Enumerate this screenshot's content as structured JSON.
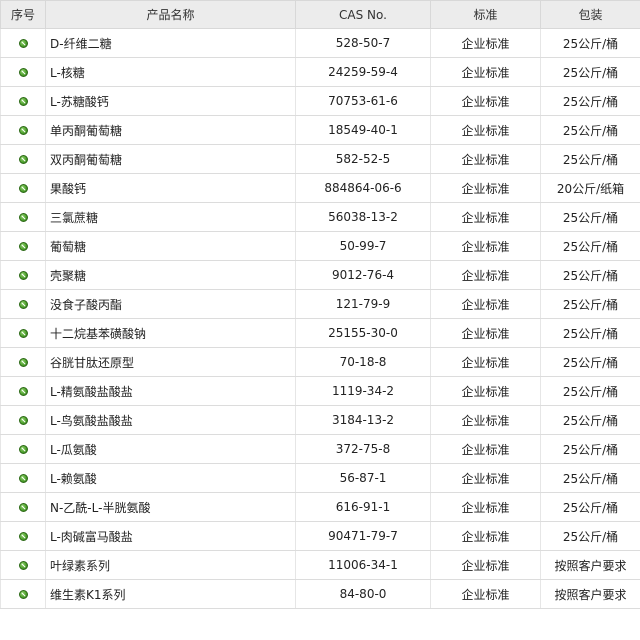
{
  "table": {
    "headers": [
      "序号",
      "产品名称",
      "CAS No.",
      "标准",
      "包装"
    ],
    "rows": [
      {
        "name": "D-纤维二糖",
        "cas": "528-50-7",
        "standard": "企业标准",
        "packaging": "25公斤/桶"
      },
      {
        "name": "L-核糖",
        "cas": "24259-59-4",
        "standard": "企业标准",
        "packaging": "25公斤/桶"
      },
      {
        "name": "L-苏糖酸钙",
        "cas": "70753-61-6",
        "standard": "企业标准",
        "packaging": "25公斤/桶"
      },
      {
        "name": "单丙酮葡萄糖",
        "cas": "18549-40-1",
        "standard": "企业标准",
        "packaging": "25公斤/桶"
      },
      {
        "name": "双丙酮葡萄糖",
        "cas": "582-52-5",
        "standard": "企业标准",
        "packaging": "25公斤/桶"
      },
      {
        "name": "果酸钙",
        "cas": "884864-06-6",
        "standard": "企业标准",
        "packaging": "20公斤/纸箱"
      },
      {
        "name": "三氯蔗糖",
        "cas": "56038-13-2",
        "standard": "企业标准",
        "packaging": "25公斤/桶"
      },
      {
        "name": "葡萄糖",
        "cas": "50-99-7",
        "standard": "企业标准",
        "packaging": "25公斤/桶"
      },
      {
        "name": "壳聚糖",
        "cas": "9012-76-4",
        "standard": "企业标准",
        "packaging": "25公斤/桶"
      },
      {
        "name": "没食子酸丙酯",
        "cas": "121-79-9",
        "standard": "企业标准",
        "packaging": "25公斤/桶"
      },
      {
        "name": "十二烷基苯磺酸钠",
        "cas": "25155-30-0",
        "standard": "企业标准",
        "packaging": "25公斤/桶"
      },
      {
        "name": "谷胱甘肽还原型",
        "cas": "70-18-8",
        "standard": "企业标准",
        "packaging": "25公斤/桶"
      },
      {
        "name": "L-精氨酸盐酸盐",
        "cas": "1119-34-2",
        "standard": "企业标准",
        "packaging": "25公斤/桶"
      },
      {
        "name": "L-鸟氨酸盐酸盐",
        "cas": "3184-13-2",
        "standard": "企业标准",
        "packaging": "25公斤/桶"
      },
      {
        "name": "L-瓜氨酸",
        "cas": "372-75-8",
        "standard": "企业标准",
        "packaging": "25公斤/桶"
      },
      {
        "name": "L-赖氨酸",
        "cas": "56-87-1",
        "standard": "企业标准",
        "packaging": "25公斤/桶"
      },
      {
        "name": "N-乙酰-L-半胱氨酸",
        "cas": "616-91-1",
        "standard": "企业标准",
        "packaging": "25公斤/桶"
      },
      {
        "name": "L-肉碱富马酸盐",
        "cas": "90471-79-7",
        "standard": "企业标准",
        "packaging": "25公斤/桶"
      },
      {
        "name": "叶绿素系列",
        "cas": "11006-34-1",
        "standard": "企业标准",
        "packaging": "按照客户要求"
      },
      {
        "name": "维生素K1系列",
        "cas": "84-80-0",
        "standard": "企业标准",
        "packaging": "按照客户要求"
      }
    ]
  },
  "icons": {
    "row_bullet": "green-check-circle-icon"
  },
  "colors": {
    "header_bg": "#ececec",
    "bullet": "#4a9d2a",
    "border": "#dcdcdc"
  }
}
